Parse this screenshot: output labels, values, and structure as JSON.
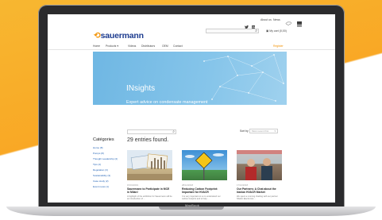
{
  "device": {
    "label": "MacBook"
  },
  "header": {
    "top_links": [
      "About us",
      "News"
    ],
    "logo_text": "sauermann",
    "search": {
      "placeholder": ""
    },
    "cart_label": "My cart (0,00)"
  },
  "nav": {
    "items": [
      "Home",
      "Products",
      "Videos",
      "Distributors",
      "OEM",
      "Contact"
    ],
    "cta": "Register"
  },
  "hero": {
    "title": "INsights",
    "subtitle": "Expert advice on condensate management"
  },
  "filters": {
    "sort_label": "Sort by",
    "sort_value": "Most recent first"
  },
  "sidebar": {
    "title": "Catégories",
    "items": [
      "Home (8)",
      "Pumps (8)",
      "Thought Leadership (2)",
      "Tips (4)",
      "Regulation (3)",
      "Sustainability (3)",
      "Case study (2)",
      "Event news (1)"
    ]
  },
  "results": {
    "count_text": "29 entries found."
  },
  "cards": [
    {
      "date": "15/01/2019",
      "title": "Sauermann to Participate in MCE in Milan!",
      "excerpt": "A highlight of the exhibition for Sauermann will be an introduction of ..."
    },
    {
      "date": "28/12/2018",
      "title": "Reducing Carbon Footprint: Important for HVACR",
      "excerpt": "It is very important to us to understand our carbon footprint and to help ..."
    },
    {
      "date": "17/12/2018",
      "title": "Our Partners: A Chat about the Iranian HVACR Market",
      "excerpt": "We spent a morning chatting with our partner Shahin Electronics ..."
    }
  ],
  "colors": {
    "background_orange": "#f9a825",
    "brand_blue": "#1d3c8f",
    "brand_orange": "#f29100",
    "hero_blue": "#7cbde6",
    "link_blue": "#1d5fb4"
  }
}
